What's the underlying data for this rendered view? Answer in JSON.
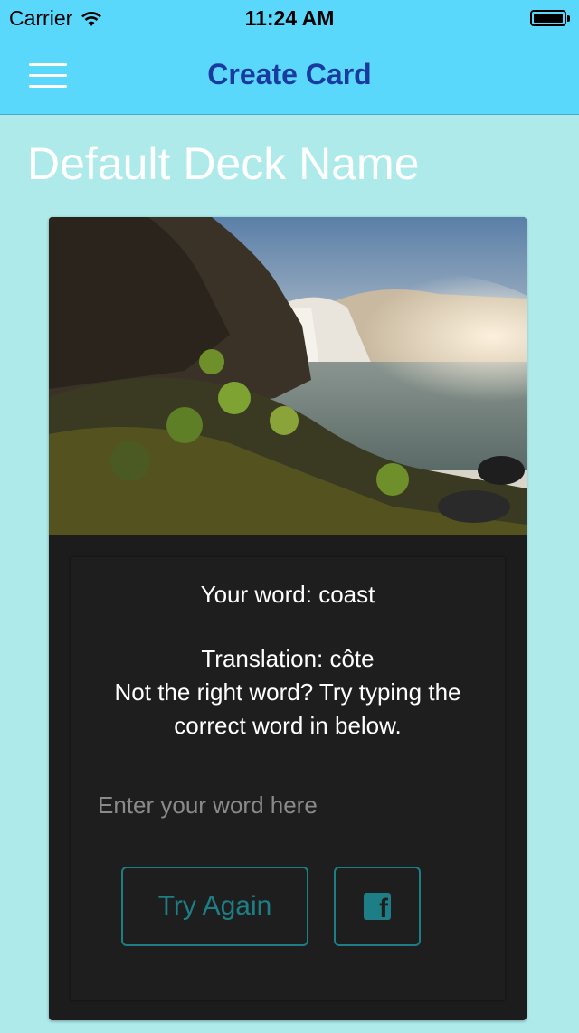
{
  "status_bar": {
    "carrier": "Carrier",
    "time": "11:24 AM"
  },
  "nav": {
    "title": "Create Card"
  },
  "deck": {
    "name": "Default Deck Name"
  },
  "card": {
    "word_line": "Your word: coast",
    "translation_line": "Translation: côte",
    "hint_line1": "Not the right word? Try typing the",
    "hint_line2": "correct word in below.",
    "input_placeholder": "Enter your word here",
    "input_value": "",
    "try_again_label": "Try Again",
    "share_icon": "facebook-icon"
  },
  "colors": {
    "header": "#5ad8fb",
    "background": "#aeeaea",
    "title": "#1a3aa0",
    "accent": "#1d7e86",
    "card": "#1c1c1c"
  }
}
